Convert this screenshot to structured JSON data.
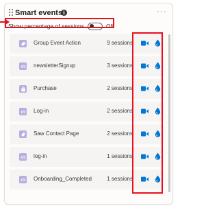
{
  "header": {
    "title": "Smart events",
    "info_glyph": "i",
    "more_glyph": "···"
  },
  "toggle": {
    "label": "Show percentage of sessions",
    "state": "Off"
  },
  "events": [
    {
      "name": "Group Event Action",
      "count": "9 sessions",
      "icon": "tag-icon"
    },
    {
      "name": "newsletterSignup",
      "count": "3 sessions",
      "icon": "code-icon"
    },
    {
      "name": "Purchase",
      "count": "2 sessions",
      "icon": "bag-icon"
    },
    {
      "name": "Log-in",
      "count": "2 sessions",
      "icon": "code-icon"
    },
    {
      "name": "Saw Contact Page",
      "count": "2 sessions",
      "icon": "tag-icon"
    },
    {
      "name": "log-in",
      "count": "1 sessions",
      "icon": "code-icon"
    },
    {
      "name": "Onboarding_Completed",
      "count": "1 sessions",
      "icon": "code-icon"
    }
  ],
  "colors": {
    "accent": "#0078d4",
    "event_icon_bg": "#b7aee0",
    "highlight": "#e8101e"
  }
}
